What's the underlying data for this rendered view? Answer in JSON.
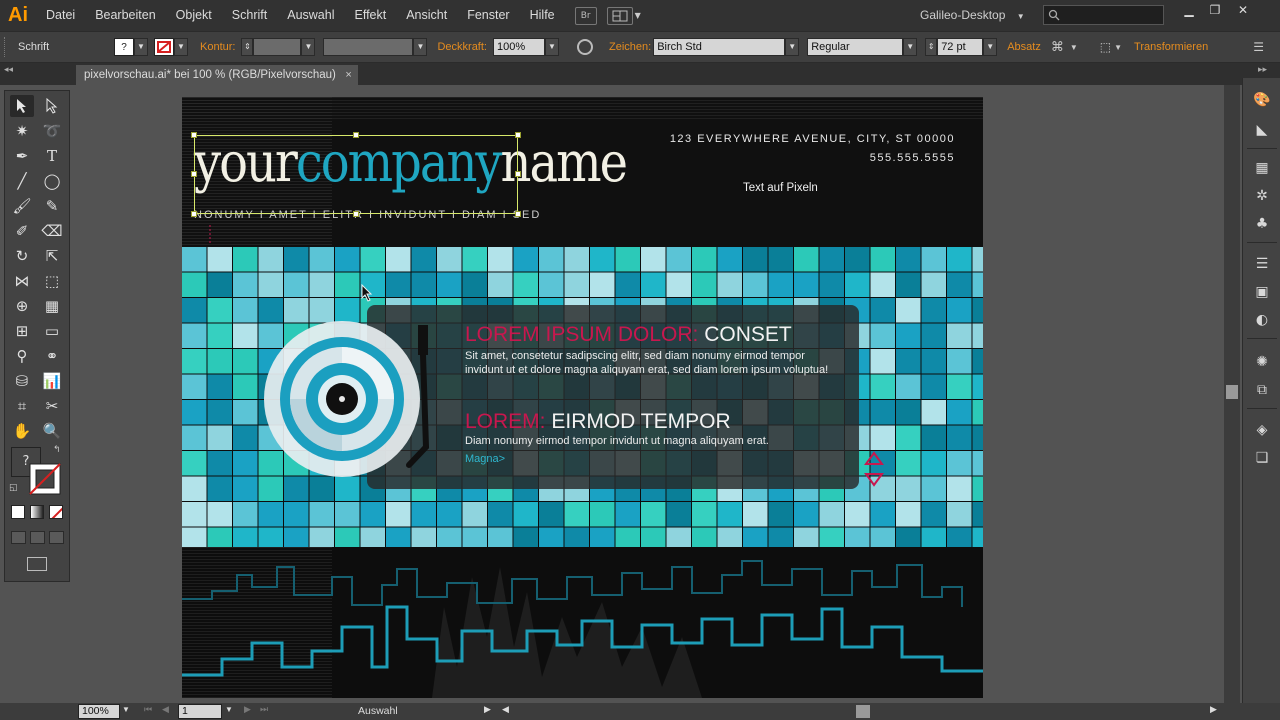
{
  "app": {
    "logo": "Ai",
    "menu": [
      "Datei",
      "Bearbeiten",
      "Objekt",
      "Schrift",
      "Auswahl",
      "Effekt",
      "Ansicht",
      "Fenster",
      "Hilfe"
    ],
    "bridge_label": "Br",
    "workspace": "Galileo-Desktop",
    "accent": "#ff9a00"
  },
  "control": {
    "mode": "Schrift",
    "stroke_label": "Kontur:",
    "opacity_label": "Deckkraft:",
    "opacity_value": "100%",
    "char_label": "Zeichen:",
    "font_family": "Birch Std",
    "font_style": "Regular",
    "font_size": "72 pt",
    "paragraph_label": "Absatz",
    "transform_label": "Transformieren",
    "fill_symbol": "?"
  },
  "document": {
    "tab_title": "pixelvorschau.ai* bei 100 % (RGB/Pixelvorschau)",
    "close_symbol": "×"
  },
  "artwork": {
    "logo_part1": "your",
    "logo_part2": "company",
    "logo_part3": "name",
    "tagline": "NONUMY   I   AMET   I   ELITR   I   INVIDUNT   I   DIAM   I   SED",
    "address_line1": "123 EVERYWHERE AVENUE, CITY, ST 00000",
    "address_line2": "555.555.5555",
    "pixel_label": "Text auf Pixeln",
    "headline1_pink": "LOREM IPSUM DOLOR:",
    "headline1_white": " CONSET",
    "body1": "Sit amet, consetetur sadipscing elitr, sed diam nonumy eirmod tempor invidunt ut et dolore magna aliquyam erat, sed diam lorem ipsum voluptua!",
    "headline2_pink": "LOREM:",
    "headline2_white": " EIRMOD TEMPOR",
    "body2": "Diam nonumy eirmod tempor invidunt ut magna aliquyam erat.",
    "link": "Magna>",
    "colors": {
      "pink": "#c8174e",
      "teal": "#1fa6c1",
      "cream": "#f2f0e4"
    }
  },
  "status": {
    "zoom": "100%",
    "artboard_number": "1",
    "selection_label": "Auswahl"
  }
}
